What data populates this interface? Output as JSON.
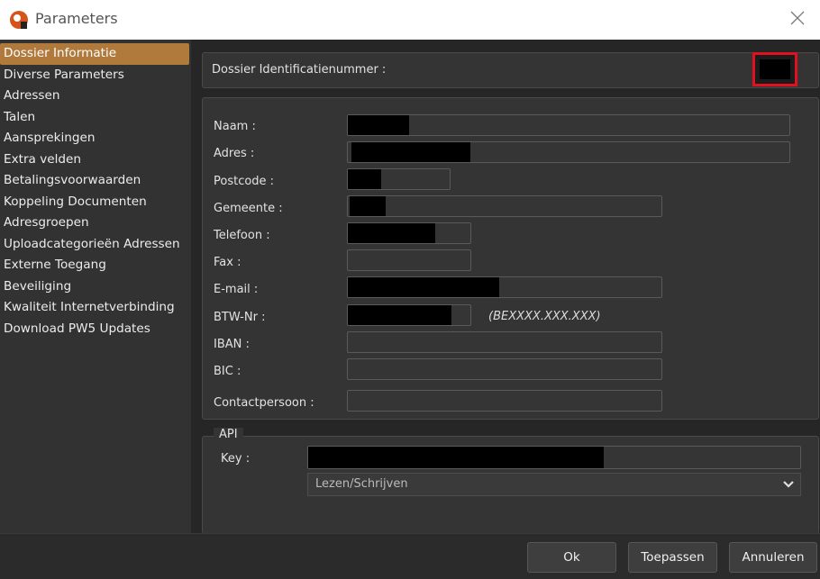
{
  "window": {
    "title": "Parameters",
    "app_icon": "app-logo-icon",
    "close_icon": "close-icon"
  },
  "sidebar": {
    "items": [
      {
        "label": "Dossier Informatie",
        "active": true
      },
      {
        "label": "Diverse Parameters"
      },
      {
        "label": "Adressen"
      },
      {
        "label": "Talen"
      },
      {
        "label": "Aansprekingen"
      },
      {
        "label": "Extra velden"
      },
      {
        "label": "Betalingsvoorwaarden"
      },
      {
        "label": "Koppeling Documenten"
      },
      {
        "label": "Adresgroepen"
      },
      {
        "label": "Uploadcategorieën Adressen"
      },
      {
        "label": "Externe Toegang"
      },
      {
        "label": "Beveiliging"
      },
      {
        "label": "Kwaliteit Internetverbinding"
      },
      {
        "label": "Download PW5 Updates"
      }
    ]
  },
  "dossier": {
    "id_label": "Dossier Identificatienummer :"
  },
  "form": {
    "naam_label": "Naam :",
    "adres_label": "Adres :",
    "postcode_label": "Postcode :",
    "gemeente_label": "Gemeente :",
    "telefoon_label": "Telefoon :",
    "fax_label": "Fax :",
    "email_label": "E-mail :",
    "btw_label": "BTW-Nr :",
    "btw_hint": "(BEXXXX.XXX.XXX)",
    "iban_label": "IBAN :",
    "bic_label": "BIC :",
    "contact_label": "Contactpersoon :"
  },
  "api": {
    "legend": "API",
    "key_label": "Key :",
    "mode_value": "Lezen/Schrijven"
  },
  "buttons": {
    "ok": "Ok",
    "apply": "Toepassen",
    "cancel": "Annuleren"
  },
  "colors": {
    "active_item": "#b07a3c",
    "highlight_border": "#e0121f"
  }
}
